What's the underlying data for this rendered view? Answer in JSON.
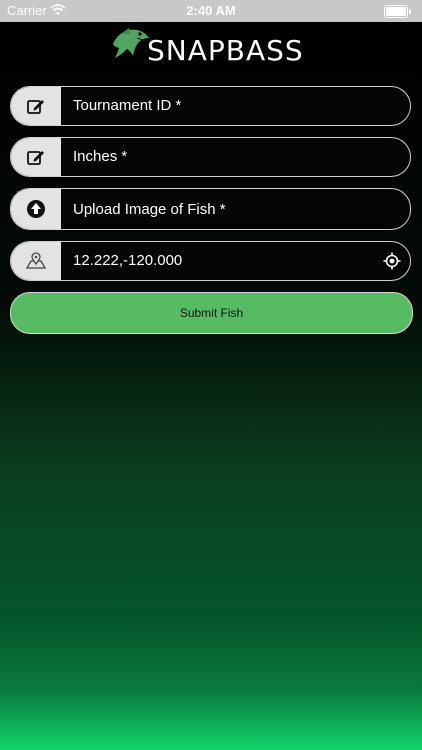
{
  "status_bar": {
    "carrier": "Carrier",
    "time": "2:40 AM"
  },
  "header": {
    "logo_text": "SNAPBASS"
  },
  "form": {
    "tournament_id": {
      "placeholder": "Tournament ID *",
      "icon": "edit-icon"
    },
    "inches": {
      "placeholder": "Inches *",
      "icon": "edit-icon"
    },
    "upload": {
      "label": "Upload Image of Fish *",
      "icon": "upload-icon"
    },
    "location": {
      "value": "12.222,-120.000",
      "icon": "map-icon",
      "action_icon": "crosshair-icon"
    },
    "submit_label": "Submit Fish"
  },
  "colors": {
    "submit_bg": "#56bb63",
    "gradient_bottom": "#12d56a"
  }
}
